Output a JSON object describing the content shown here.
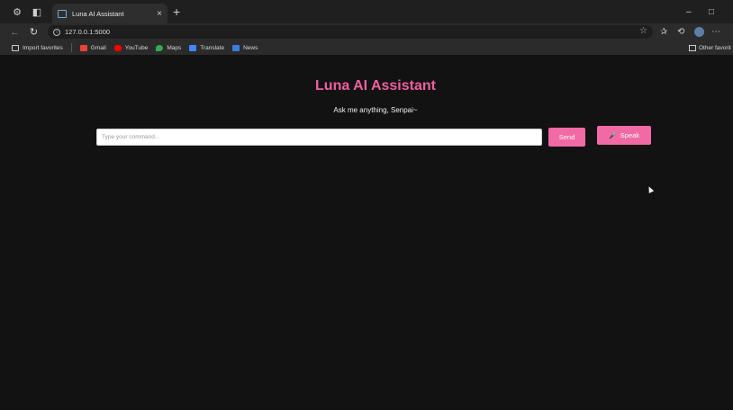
{
  "browser": {
    "tab": {
      "title": "Luna AI Assistant",
      "close_glyph": "×",
      "new_tab_glyph": "+"
    },
    "window_controls": {
      "minimize": "–",
      "maximize": "□"
    },
    "address": {
      "url": "127.0.0.1:5000"
    },
    "toolbar_icons": [
      "back-icon",
      "refresh-icon",
      "favorite-star-icon",
      "favorites-icon",
      "history-icon",
      "profile-icon",
      "more-icon"
    ],
    "favorites": [
      {
        "label": "Import favorites",
        "icon": "folder-icon",
        "color": "#cfcfcf"
      },
      {
        "label": "Gmail",
        "icon": "gmail-icon",
        "color": "#ea4335"
      },
      {
        "label": "YouTube",
        "icon": "youtube-icon",
        "color": "#ff0000"
      },
      {
        "label": "Maps",
        "icon": "maps-icon",
        "color": "#34a853"
      },
      {
        "label": "Translate",
        "icon": "translate-icon",
        "color": "#4285f4"
      },
      {
        "label": "News",
        "icon": "news-icon",
        "color": "#3b7ddd"
      }
    ],
    "other_favorites": "Other favorit"
  },
  "app": {
    "title": "Luna AI Assistant",
    "subtitle": "Ask me anything, Senpai~",
    "input_placeholder": "Type your command...",
    "input_value": "",
    "send_label": "Send",
    "speak_label": "Speak",
    "speak_icon": "🎤",
    "accent_color": "#f26aa5",
    "title_color": "#ef5f9e",
    "background": "#121212"
  }
}
